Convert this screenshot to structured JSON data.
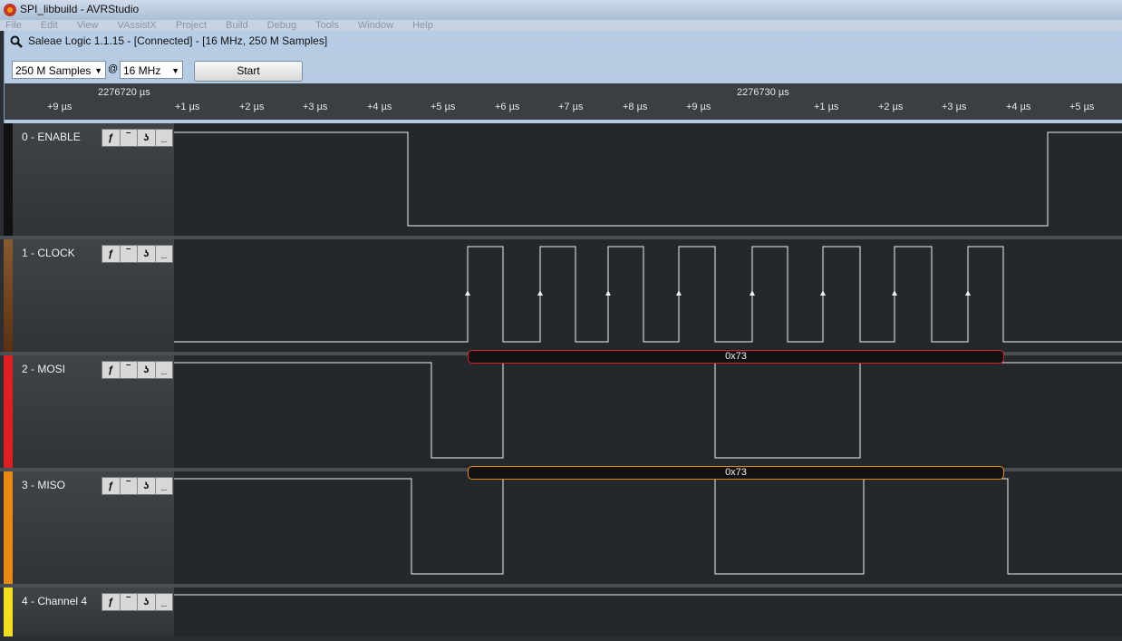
{
  "outer_window": {
    "title": "SPI_libbuild - AVRStudio",
    "menu": [
      "File",
      "Edit",
      "View",
      "VAssistX",
      "Project",
      "Build",
      "Debug",
      "Tools",
      "Window",
      "Help"
    ]
  },
  "app": {
    "title": "Saleae Logic 1.1.15 - [Connected] - [16 MHz, 250 M Samples]",
    "toolbar": {
      "samples_value": "250 M Samples",
      "at_symbol": "@",
      "rate_value": "16 MHz",
      "start_label": "Start"
    }
  },
  "timeline": {
    "major_labels": [
      "2276720 µs",
      "2276730 µs"
    ],
    "ticks": [
      "+9 µs",
      "+1 µs",
      "+2 µs",
      "+3 µs",
      "+4 µs",
      "+5 µs",
      "+6 µs",
      "+7 µs",
      "+8 µs",
      "+9 µs",
      "+1 µs",
      "+2 µs",
      "+3 µs",
      "+4 µs",
      "+5 µs"
    ]
  },
  "channels": [
    {
      "name": "0 - ENABLE",
      "color": "#111111"
    },
    {
      "name": "1 - CLOCK",
      "color": "#7a4a22"
    },
    {
      "name": "2 - MOSI",
      "color": "#e02020",
      "decode": "0x73"
    },
    {
      "name": "3 - MISO",
      "color": "#e88a10",
      "decode": "0x73"
    },
    {
      "name": "4 - Channel 4",
      "color": "#f2e020"
    }
  ],
  "trigger_buttons": [
    "rising-edge",
    "high",
    "falling-edge",
    "low"
  ]
}
